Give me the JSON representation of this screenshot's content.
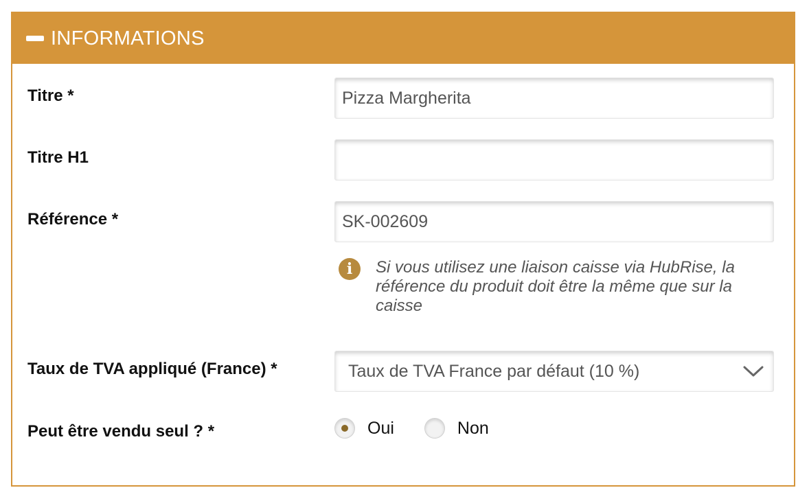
{
  "panel": {
    "title": "INFORMATIONS",
    "accent_color": "#d5953a"
  },
  "fields": {
    "titre": {
      "label": "Titre *",
      "value": "Pizza Margherita"
    },
    "titre_h1": {
      "label": "Titre H1",
      "value": ""
    },
    "reference": {
      "label": "Référence *",
      "value": "SK-002609",
      "help": "Si vous utilisez une liaison caisse via HubRise, la référence du produit doit être la même que sur la caisse"
    },
    "tva": {
      "label": "Taux de TVA appliqué (France) *",
      "selected": "Taux de TVA France par défaut (10 %)"
    },
    "vendu_seul": {
      "label": "Peut être vendu seul ? *",
      "options": [
        "Oui",
        "Non"
      ],
      "selected": "Oui"
    }
  },
  "icons": {
    "collapse": "minus-icon",
    "info": "info-icon",
    "dropdown": "chevron-down-icon"
  }
}
